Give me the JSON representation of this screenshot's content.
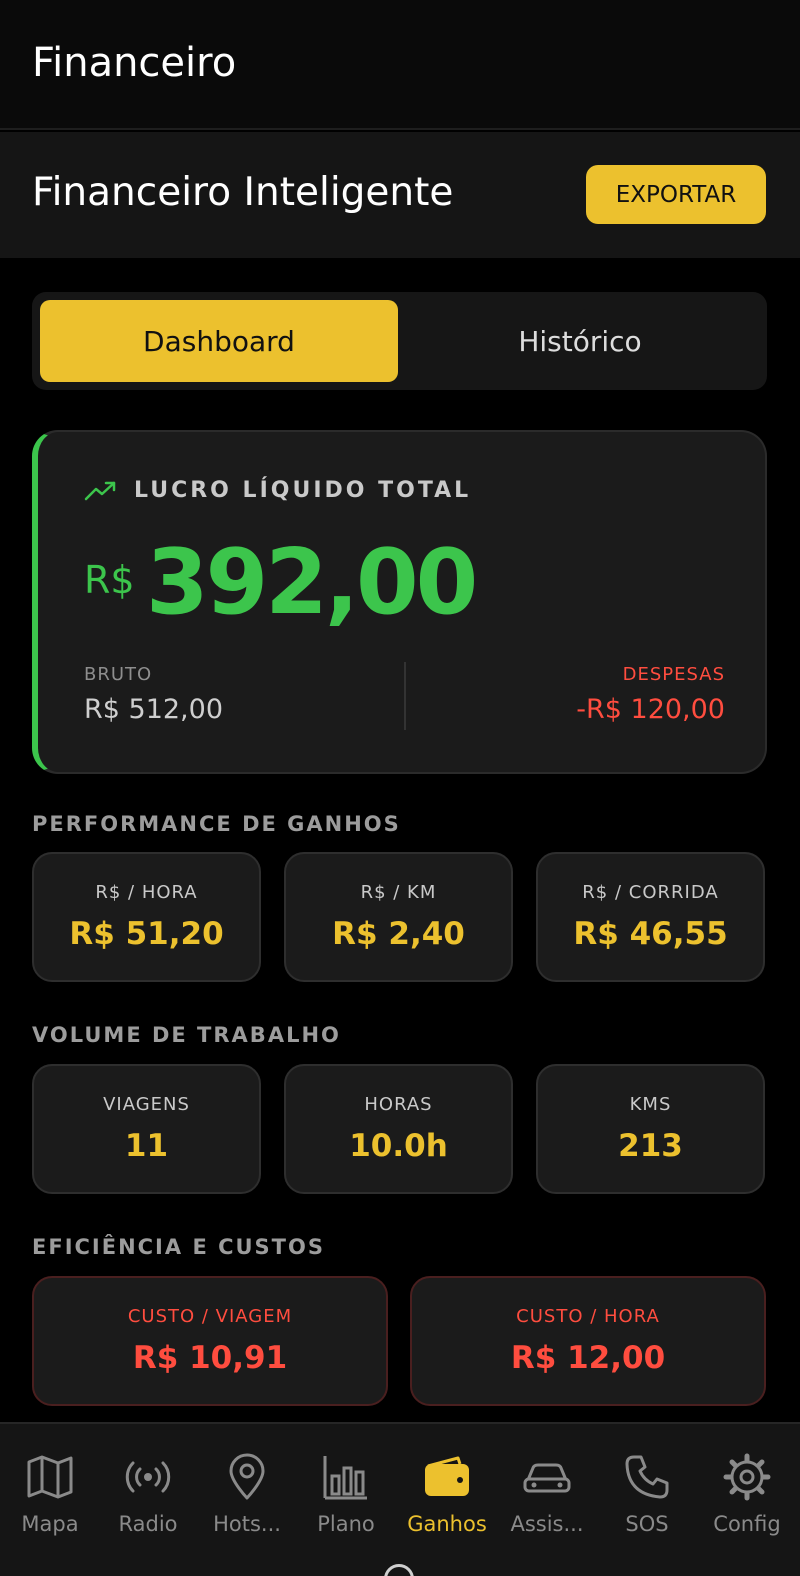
{
  "appbar": {
    "title": "Financeiro"
  },
  "header": {
    "title": "Financeiro Inteligente",
    "export_label": "EXPORTAR"
  },
  "tabs": [
    {
      "label": "Dashboard",
      "active": true
    },
    {
      "label": "Histórico",
      "active": false
    }
  ],
  "profit": {
    "label": "LUCRO LÍQUIDO TOTAL",
    "currency": "R$",
    "value": "392,00",
    "bruto_label": "BRUTO",
    "bruto_value": "R$ 512,00",
    "despesas_label": "DESPESAS",
    "despesas_value": "-R$ 120,00"
  },
  "performance": {
    "title": "PERFORMANCE DE GANHOS",
    "items": [
      {
        "label": "R$ / HORA",
        "value": "R$ 51,20"
      },
      {
        "label": "R$ / KM",
        "value": "R$ 2,40"
      },
      {
        "label": "R$ / CORRIDA",
        "value": "R$ 46,55"
      }
    ]
  },
  "volume": {
    "title": "VOLUME DE TRABALHO",
    "items": [
      {
        "label": "VIAGENS",
        "value": "11"
      },
      {
        "label": "HORAS",
        "value": "10.0h"
      },
      {
        "label": "KMS",
        "value": "213"
      }
    ]
  },
  "efficiency": {
    "title": "EFICIÊNCIA E CUSTOS",
    "items": [
      {
        "label": "CUSTO / VIAGEM",
        "value": "R$ 10,91"
      },
      {
        "label": "CUSTO / HORA",
        "value": "R$ 12,00"
      }
    ]
  },
  "nav": [
    {
      "label": "Mapa",
      "icon": "map-icon"
    },
    {
      "label": "Radio",
      "icon": "radio-icon"
    },
    {
      "label": "Hots...",
      "icon": "location-pin-icon"
    },
    {
      "label": "Plano",
      "icon": "bar-chart-icon"
    },
    {
      "label": "Ganhos",
      "icon": "wallet-icon",
      "active": true
    },
    {
      "label": "Assis...",
      "icon": "car-icon"
    },
    {
      "label": "SOS",
      "icon": "phone-icon"
    },
    {
      "label": "Config",
      "icon": "gear-icon"
    }
  ],
  "colors": {
    "accent": "#ecc12e",
    "profit": "#3cc54c",
    "expense": "#ff4d3f",
    "background": "#000000"
  }
}
